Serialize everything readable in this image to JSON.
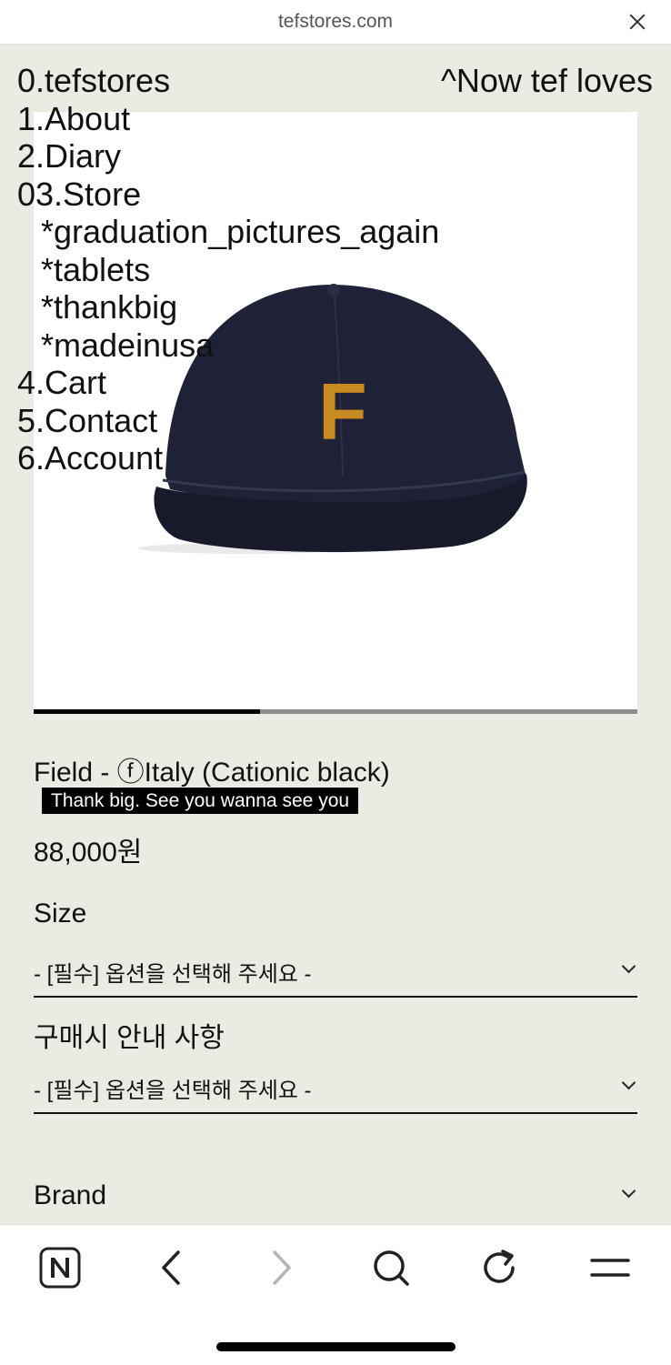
{
  "browser": {
    "url": "tefstores.com"
  },
  "menu": {
    "items": [
      "0.tefstores",
      "1.About",
      "2.Diary",
      "03.Store"
    ],
    "subitems": [
      "*graduation_pictures_again",
      "*tablets",
      "*thankbig",
      "*madeinusa"
    ],
    "items2": [
      "4.Cart",
      "5.Contact",
      "6.Account"
    ]
  },
  "tagline": "^Now tef loves",
  "product": {
    "title": "Field - ⓕItaly (Cationic black)",
    "caption": "Thank big. See you wanna see you",
    "price": "88,000원",
    "gallery_progress": 0.375,
    "image": "black-cap-with-gold-f-logo"
  },
  "options": [
    {
      "label": "Size",
      "value": "- [필수] 옵션을 선택해 주세요 -"
    },
    {
      "label": "구매시 안내 사항",
      "value": "- [필수] 옵션을 선택해 주세요 -"
    }
  ],
  "brand_label": "Brand",
  "bottom_nav": [
    "naver-home-icon",
    "back-icon",
    "forward-icon",
    "search-icon",
    "refresh-icon",
    "menu-icon"
  ],
  "colors": {
    "background": "#ecebe3",
    "cap": "#1c1f33",
    "logo": "#c98a22"
  }
}
